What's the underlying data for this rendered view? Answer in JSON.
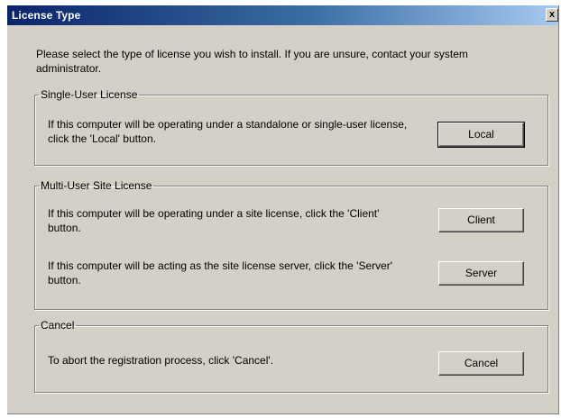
{
  "window": {
    "title": "License Type",
    "close_label": "x"
  },
  "intro": "Please select the type of license you wish to install.  If you are unsure, contact your system administrator.",
  "single_user": {
    "legend": "Single-User License",
    "description": "If this computer will be operating under a standalone or single-user license, click the 'Local' button.",
    "button_label": "Local"
  },
  "multi_user": {
    "legend": "Multi-User Site License",
    "client_description": "If this computer will be operating under a site license, click the 'Client' button.",
    "client_button_label": "Client",
    "server_description": "If this computer will be acting as the site license server, click the 'Server' button.",
    "server_button_label": "Server"
  },
  "cancel": {
    "legend": "Cancel",
    "description": "To abort the registration process, click 'Cancel'.",
    "button_label": "Cancel"
  },
  "colors": {
    "dialog_bg": "#d4d0c8",
    "titlebar_start": "#0a246a",
    "titlebar_end": "#a6caf0"
  }
}
